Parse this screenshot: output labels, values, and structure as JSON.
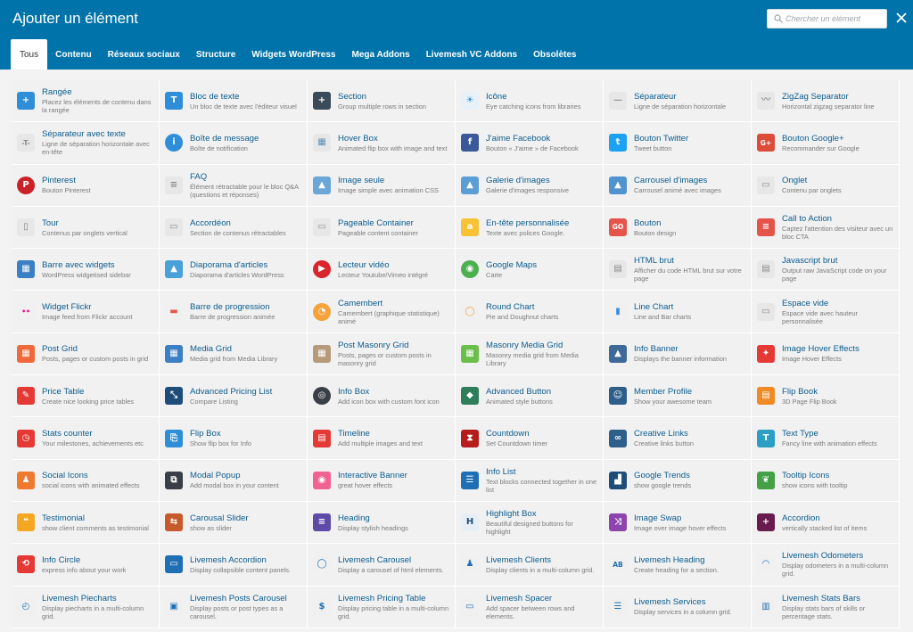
{
  "dialog": {
    "title": "Ajouter un élément",
    "search_placeholder": "Chercher un élément"
  },
  "tabs": [
    {
      "label": "Tous",
      "active": true
    },
    {
      "label": "Contenu"
    },
    {
      "label": "Réseaux sociaux"
    },
    {
      "label": "Structure"
    },
    {
      "label": "Widgets WordPress"
    },
    {
      "label": "Mega Addons"
    },
    {
      "label": "Livemesh VC Addons"
    },
    {
      "label": "Obsolètes"
    }
  ],
  "colors": {
    "header": "#0073aa",
    "link": "#0b5c8f"
  },
  "elements": [
    {
      "name": "Rangée",
      "desc": "Placez les éléments de contenu dans la rangée",
      "icon": "plus-icon",
      "glyph": "+",
      "color": "#2e8fd8"
    },
    {
      "name": "Bloc de texte",
      "desc": "Un bloc de texte avec l'éditeur visuel",
      "icon": "text-block-icon",
      "glyph": "T",
      "color": "#2e8fd8"
    },
    {
      "name": "Section",
      "desc": "Group multiple rows in section",
      "icon": "section-plus-icon",
      "glyph": "+",
      "color": "#3b4a58"
    },
    {
      "name": "Icône",
      "desc": "Eye catching icons from libraries",
      "icon": "sun-icon",
      "glyph": "☀",
      "color": "#e8f1f8",
      "fg": "#2e8fd8"
    },
    {
      "name": "Séparateur",
      "desc": "Ligne de séparation horizontale",
      "icon": "separator-icon",
      "glyph": "—",
      "color": "#e7e7e7",
      "fg": "#999"
    },
    {
      "name": "ZigZag Separator",
      "desc": "Horizontal zigzag separator line",
      "icon": "zigzag-icon",
      "glyph": "〰",
      "color": "#e7e7e7",
      "fg": "#999"
    },
    {
      "name": "Séparateur avec texte",
      "desc": "Ligne de séparation horizontale avec en-tête",
      "icon": "text-separator-icon",
      "glyph": "-T-",
      "color": "#e7e7e7",
      "fg": "#888"
    },
    {
      "name": "Boîte de message",
      "desc": "Boîte de notification",
      "icon": "info-icon",
      "glyph": "i",
      "color": "#2e8fd8",
      "round": true
    },
    {
      "name": "Hover Box",
      "desc": "Animated flip box with image and text",
      "icon": "hover-box-icon",
      "glyph": "▦",
      "color": "#e7e7e7",
      "fg": "#5a8fb8"
    },
    {
      "name": "J'aime Facebook",
      "desc": "Bouton « J'aime » de Facebook",
      "icon": "facebook-icon",
      "glyph": "f",
      "color": "#3b5998"
    },
    {
      "name": "Bouton Twitter",
      "desc": "Tweet button",
      "icon": "twitter-icon",
      "glyph": "t",
      "color": "#1da1f2"
    },
    {
      "name": "Bouton Google+",
      "desc": "Recommander sur Google",
      "icon": "google-plus-icon",
      "glyph": "G+",
      "color": "#dd4b39"
    },
    {
      "name": "Pinterest",
      "desc": "Bouton Pinterest",
      "icon": "pinterest-icon",
      "glyph": "P",
      "color": "#cb2027",
      "round": true
    },
    {
      "name": "FAQ",
      "desc": "Élément rétractable pour le bloc Q&A (questions et réponses)",
      "icon": "faq-icon",
      "glyph": "≡",
      "color": "#e7e7e7",
      "fg": "#888"
    },
    {
      "name": "Image seule",
      "desc": "Image simple avec animation CSS",
      "icon": "image-icon",
      "glyph": "▲",
      "color": "#6aa7d8"
    },
    {
      "name": "Galerie d'images",
      "desc": "Galerie d'images responsive",
      "icon": "gallery-icon",
      "glyph": "▲",
      "color": "#5b9ed6"
    },
    {
      "name": "Carrousel d'images",
      "desc": "Carrousel animé avec images",
      "icon": "carousel-icon",
      "glyph": "▲",
      "color": "#4f93cf"
    },
    {
      "name": "Onglet",
      "desc": "Contenu par onglets",
      "icon": "tab-icon",
      "glyph": "▭",
      "color": "#e7e7e7",
      "fg": "#888"
    },
    {
      "name": "Tour",
      "desc": "Contenus par onglets vertical",
      "icon": "tour-icon",
      "glyph": "▯",
      "color": "#e7e7e7",
      "fg": "#888"
    },
    {
      "name": "Accordéon",
      "desc": "Section de contenus rétractables",
      "icon": "accordion-icon",
      "glyph": "▭",
      "color": "#e7e7e7",
      "fg": "#888"
    },
    {
      "name": "Pageable Container",
      "desc": "Pageable content container",
      "icon": "pageable-icon",
      "glyph": "▭",
      "color": "#e7e7e7",
      "fg": "#888"
    },
    {
      "name": "En-tête personnalisée",
      "desc": "Texte avec polices Google.",
      "icon": "custom-heading-icon",
      "glyph": "a",
      "color": "#f7c233"
    },
    {
      "name": "Bouton",
      "desc": "Bouton design",
      "icon": "button-icon",
      "glyph": "GO",
      "color": "#e5544a"
    },
    {
      "name": "Call to Action",
      "desc": "Captez l'attention des visiteur avec un bloc CTA",
      "icon": "cta-icon",
      "glyph": "≡",
      "color": "#e5544a"
    },
    {
      "name": "Barre avec widgets",
      "desc": "WordPress widgetised sidebar",
      "icon": "widget-bar-icon",
      "glyph": "▦",
      "color": "#3b7fc4"
    },
    {
      "name": "Diaporama d'articles",
      "desc": "Diaporama d'articles WordPress",
      "icon": "post-slider-icon",
      "glyph": "▲",
      "color": "#4aa0d8"
    },
    {
      "name": "Lecteur vidéo",
      "desc": "Lecteur Youtube/Vimeo intégré",
      "icon": "video-icon",
      "glyph": "▶",
      "color": "#d9252b",
      "round": true
    },
    {
      "name": "Google Maps",
      "desc": "Carte",
      "icon": "maps-icon",
      "glyph": "◉",
      "color": "#4caf50",
      "round": true
    },
    {
      "name": "HTML brut",
      "desc": "Afficher du code HTML brut sur votre page",
      "icon": "raw-html-icon",
      "glyph": "▤",
      "color": "#e7e7e7",
      "fg": "#888"
    },
    {
      "name": "Javascript brut",
      "desc": "Output raw JavaScript code on your page",
      "icon": "raw-js-icon",
      "glyph": "▤",
      "color": "#e7e7e7",
      "fg": "#888"
    },
    {
      "name": "Widget Flickr",
      "desc": "Image feed from Flickr account",
      "icon": "flickr-icon",
      "glyph": "••",
      "color": "#f0f0f0",
      "fg": "#ff0084"
    },
    {
      "name": "Barre de progression",
      "desc": "Barre de progression animée",
      "icon": "progress-bar-icon",
      "glyph": "▬",
      "color": "#f0f0f0",
      "fg": "#e5544a"
    },
    {
      "name": "Camembert",
      "desc": "Camembert (graphique statistique) animé",
      "icon": "pie-chart-icon",
      "glyph": "◔",
      "color": "#f3a33a",
      "round": true
    },
    {
      "name": "Round Chart",
      "desc": "Pie and Doughnut charts",
      "icon": "round-chart-icon",
      "glyph": "◯",
      "color": "#f0f0f0",
      "fg": "#f39c35",
      "round": true
    },
    {
      "name": "Line Chart",
      "desc": "Line and Bar charts",
      "icon": "line-chart-icon",
      "glyph": "▮",
      "color": "#f0f0f0",
      "fg": "#3b8fd8"
    },
    {
      "name": "Espace vide",
      "desc": "Espace vide avec hauteur personnalisée",
      "icon": "empty-space-icon",
      "glyph": "▭",
      "color": "#e7e7e7",
      "fg": "#888"
    },
    {
      "name": "Post Grid",
      "desc": "Posts, pages or custom posts in grid",
      "icon": "post-grid-icon",
      "glyph": "▦",
      "color": "#ef6a3a"
    },
    {
      "name": "Media Grid",
      "desc": "Media grid from Media Library",
      "icon": "media-grid-icon",
      "glyph": "▦",
      "color": "#3b7fc4"
    },
    {
      "name": "Post Masonry Grid",
      "desc": "Posts, pages or custom posts in masonry grid",
      "icon": "masonry-grid-icon",
      "glyph": "▦",
      "color": "#b59b7a"
    },
    {
      "name": "Masonry Media Grid",
      "desc": "Masonry media grid from Media Library",
      "icon": "masonry-media-icon",
      "glyph": "▦",
      "color": "#6abf4b"
    },
    {
      "name": "Info Banner",
      "desc": "Displays the banner information",
      "icon": "banner-icon",
      "glyph": "▲",
      "color": "#3d6a99"
    },
    {
      "name": "Image Hover Effects",
      "desc": "Image Hover Effects",
      "icon": "magic-wand-icon",
      "glyph": "✦",
      "color": "#e53935"
    },
    {
      "name": "Price Table",
      "desc": "Create nice looking price tables",
      "icon": "price-table-icon",
      "glyph": "✎",
      "color": "#e53935"
    },
    {
      "name": "Advanced Pricing List",
      "desc": "Compare Listing",
      "icon": "pricing-list-icon",
      "glyph": "⤡",
      "color": "#1f4d7a"
    },
    {
      "name": "Info Box",
      "desc": "Add icon box with custom font icon",
      "icon": "info-box-icon",
      "glyph": "◎",
      "color": "#3a3f47",
      "round": true
    },
    {
      "name": "Advanced Button",
      "desc": "Animated style buttons",
      "icon": "tag-icon",
      "glyph": "◆",
      "color": "#2e7d5b"
    },
    {
      "name": "Member Profile",
      "desc": "Show your awesome team",
      "icon": "member-icon",
      "glyph": "☺",
      "color": "#2e5f8a"
    },
    {
      "name": "Flip Book",
      "desc": "3D Page Flip Book",
      "icon": "flip-book-icon",
      "glyph": "▤",
      "color": "#f08a24"
    },
    {
      "name": "Stats counter",
      "desc": "Your milestones, achievements etc",
      "icon": "counter-icon",
      "glyph": "◷",
      "color": "#e53935"
    },
    {
      "name": "Flip Box",
      "desc": "Show flip box for Info",
      "icon": "flip-box-icon",
      "glyph": "⎘",
      "color": "#2e8fd8"
    },
    {
      "name": "Timeline",
      "desc": "Add multiple images and text",
      "icon": "timeline-icon",
      "glyph": "▤",
      "color": "#e53935"
    },
    {
      "name": "Countdown",
      "desc": "Set Countdown timer",
      "icon": "hourglass-icon",
      "glyph": "⧗",
      "color": "#b71c1c"
    },
    {
      "name": "Creative Links",
      "desc": "Creative links button",
      "icon": "link-icon",
      "glyph": "∞",
      "color": "#2e5f8a"
    },
    {
      "name": "Text Type",
      "desc": "Fancy line with animation effects",
      "icon": "text-type-icon",
      "glyph": "T",
      "color": "#2c9fc4"
    },
    {
      "name": "Social Icons",
      "desc": "social icons with animated effects",
      "icon": "social-icon",
      "glyph": "♟",
      "color": "#ef7a2f"
    },
    {
      "name": "Modal Popup",
      "desc": "Add modal box in your content",
      "icon": "modal-icon",
      "glyph": "⧉",
      "color": "#3a3f47"
    },
    {
      "name": "Interactive Banner",
      "desc": "great hover effects",
      "icon": "eye-icon",
      "glyph": "◉",
      "color": "#f06292"
    },
    {
      "name": "Info List",
      "desc": "Text blocks connected together in one list",
      "icon": "list-icon",
      "glyph": "☰",
      "color": "#1f6fb4"
    },
    {
      "name": "Google Trends",
      "desc": "show google trends",
      "icon": "trends-icon",
      "glyph": "▟",
      "color": "#1f4d7a"
    },
    {
      "name": "Tooltip Icons",
      "desc": "show icons with tooltip",
      "icon": "leaf-icon",
      "glyph": "❦",
      "color": "#43a047"
    },
    {
      "name": "Testimonial",
      "desc": "show client comments as testimonial",
      "icon": "comment-icon",
      "glyph": "❝",
      "color": "#f5a623"
    },
    {
      "name": "Carousal Slider",
      "desc": "show as slider",
      "icon": "slider-icon",
      "glyph": "⇆",
      "color": "#c75a2a"
    },
    {
      "name": "Heading",
      "desc": "Display stylish headings",
      "icon": "heading-bars-icon",
      "glyph": "≡",
      "color": "#5e4ba8"
    },
    {
      "name": "Highlight Box",
      "desc": "Beautiful designed buttons for highlight",
      "icon": "highlight-icon",
      "glyph": "H",
      "color": "#e8eef5",
      "fg": "#1f4d7a"
    },
    {
      "name": "Image Swap",
      "desc": "Image over image hover effects",
      "icon": "shuffle-icon",
      "glyph": "⤨",
      "color": "#8e44ad"
    },
    {
      "name": "Accordion",
      "desc": "vertically stacked list of items",
      "icon": "plus-box-icon",
      "glyph": "+",
      "color": "#6a1b4d"
    },
    {
      "name": "Info Circle",
      "desc": "express info about your work",
      "icon": "info-circle-icon",
      "glyph": "⟲",
      "color": "#e53935"
    },
    {
      "name": "Livemesh Accordion",
      "desc": "Display collapsible content panels.",
      "icon": "lm-accordion-icon",
      "glyph": "▭",
      "color": "#1f6fb4"
    },
    {
      "name": "Livemesh Carousel",
      "desc": "Display a carousel of html elements.",
      "icon": "lm-carousel-icon",
      "glyph": "◯",
      "color": "#f0f0f0",
      "fg": "#1f6fb4"
    },
    {
      "name": "Livemesh Clients",
      "desc": "Display clients in a multi-column grid.",
      "icon": "lm-clients-icon",
      "glyph": "♟",
      "color": "#f0f0f0",
      "fg": "#1f6fb4"
    },
    {
      "name": "Livemesh Heading",
      "desc": "Create heading for a section.",
      "icon": "lm-heading-icon",
      "glyph": "AB",
      "color": "#f0f0f0",
      "fg": "#1f6fb4"
    },
    {
      "name": "Livemesh Odometers",
      "desc": "Display odometers in a multi-column grid.",
      "icon": "odometer-icon",
      "glyph": "◠",
      "color": "#f0f0f0",
      "fg": "#1f6fb4"
    },
    {
      "name": "Livemesh Piecharts",
      "desc": "Display piecharts in a multi-column grid.",
      "icon": "lm-piechart-icon",
      "glyph": "◴",
      "color": "#f0f0f0",
      "fg": "#1f6fb4"
    },
    {
      "name": "Livemesh Posts Carousel",
      "desc": "Display posts or post types as a carousel.",
      "icon": "lm-posts-carousel-icon",
      "glyph": "▣",
      "color": "#f0f0f0",
      "fg": "#1f6fb4"
    },
    {
      "name": "Livemesh Pricing Table",
      "desc": "Display pricing table in a multi-column grid.",
      "icon": "lm-pricing-icon",
      "glyph": "$",
      "color": "#f0f0f0",
      "fg": "#1f6fb4"
    },
    {
      "name": "Livemesh Spacer",
      "desc": "Add spacer between rows and elements.",
      "icon": "lm-spacer-icon",
      "glyph": "▭",
      "color": "#f0f0f0",
      "fg": "#1f6fb4"
    },
    {
      "name": "Livemesh Services",
      "desc": "Display services in a column grid.",
      "icon": "lm-services-icon",
      "glyph": "☰",
      "color": "#f0f0f0",
      "fg": "#1f6fb4"
    },
    {
      "name": "Livemesh Stats Bars",
      "desc": "Display stats bars of skills or percentage stats.",
      "icon": "lm-stats-bars-icon",
      "glyph": "▥",
      "color": "#f0f0f0",
      "fg": "#1f6fb4"
    }
  ]
}
